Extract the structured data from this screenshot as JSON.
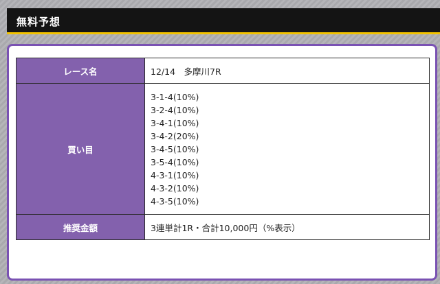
{
  "header": {
    "title": "無料予想"
  },
  "table": {
    "race_label": "レース名",
    "race_value": "12/14　多摩川7R",
    "bets_label": "買い目",
    "bets": [
      "3-1-4(10%)",
      "3-2-4(10%)",
      "3-4-1(10%)",
      "3-4-2(20%)",
      "3-4-5(10%)",
      "3-5-4(10%)",
      "4-3-1(10%)",
      "4-3-2(10%)",
      "4-3-5(10%)"
    ],
    "amount_label": "推奨金額",
    "amount_value": "3連単計1R・合計10,000円（%表示）"
  },
  "colors": {
    "accent": "#8361ad",
    "header_bg": "#141414",
    "header_underline": "#f2c300",
    "card_border": "#7a52b3"
  }
}
